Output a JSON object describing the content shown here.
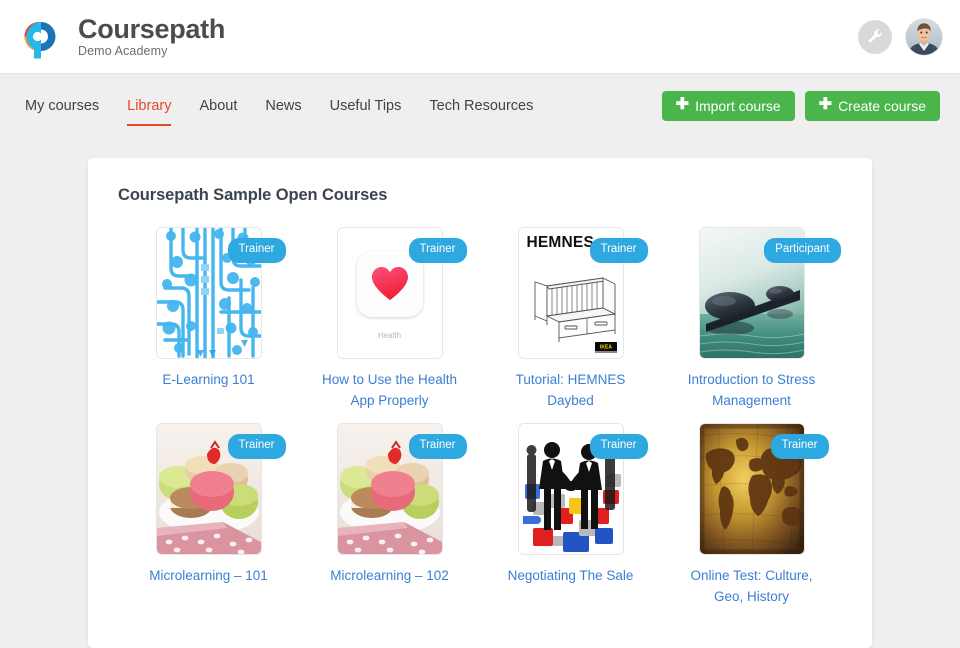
{
  "header": {
    "brand_title": "Coursepath",
    "brand_subtitle": "Demo Academy",
    "logo_icon": "cp-monogram-logo",
    "tool_icon": "wrench-icon",
    "avatar_icon": "user-avatar",
    "accent_red": "#e8472b",
    "accent_green": "#4ab54a",
    "link_blue": "#3b7fd4",
    "badge_blue": "#2ea8e0"
  },
  "nav": {
    "items": [
      {
        "label": "My courses",
        "active": false
      },
      {
        "label": "Library",
        "active": true
      },
      {
        "label": "About",
        "active": false
      },
      {
        "label": "News",
        "active": false
      },
      {
        "label": "Useful Tips",
        "active": false
      },
      {
        "label": "Tech Resources",
        "active": false
      }
    ],
    "actions": [
      {
        "label": "Import course",
        "icon": "plus-icon"
      },
      {
        "label": "Create course",
        "icon": "plus-icon"
      }
    ]
  },
  "main": {
    "panel_title": "Coursepath Sample Open Courses",
    "courses": [
      {
        "title": "E-Learning 101",
        "badge": "Trainer",
        "art": "circuit-board-thumbnail"
      },
      {
        "title": "How to Use the Health App Properly",
        "badge": "Trainer",
        "art": "health-app-icon-thumbnail",
        "health_label": "Health"
      },
      {
        "title": "Tutorial: HEMNES Daybed",
        "badge": "Trainer",
        "art": "hemnes-daybed-manual-thumbnail",
        "heading": "HEMNES"
      },
      {
        "title": "Introduction to Stress Management",
        "badge": "Participant",
        "art": "zen-stones-thumbnail"
      },
      {
        "title": "Microlearning – 101",
        "badge": "Trainer",
        "art": "macarons-thumbnail"
      },
      {
        "title": "Microlearning – 102",
        "badge": "Trainer",
        "art": "macarons-thumbnail"
      },
      {
        "title": "Negotiating The Sale",
        "badge": "Trainer",
        "art": "handshake-puzzle-thumbnail"
      },
      {
        "title": "Online Test: Culture, Geo, History",
        "badge": "Trainer",
        "art": "antique-world-map-thumbnail"
      }
    ]
  }
}
